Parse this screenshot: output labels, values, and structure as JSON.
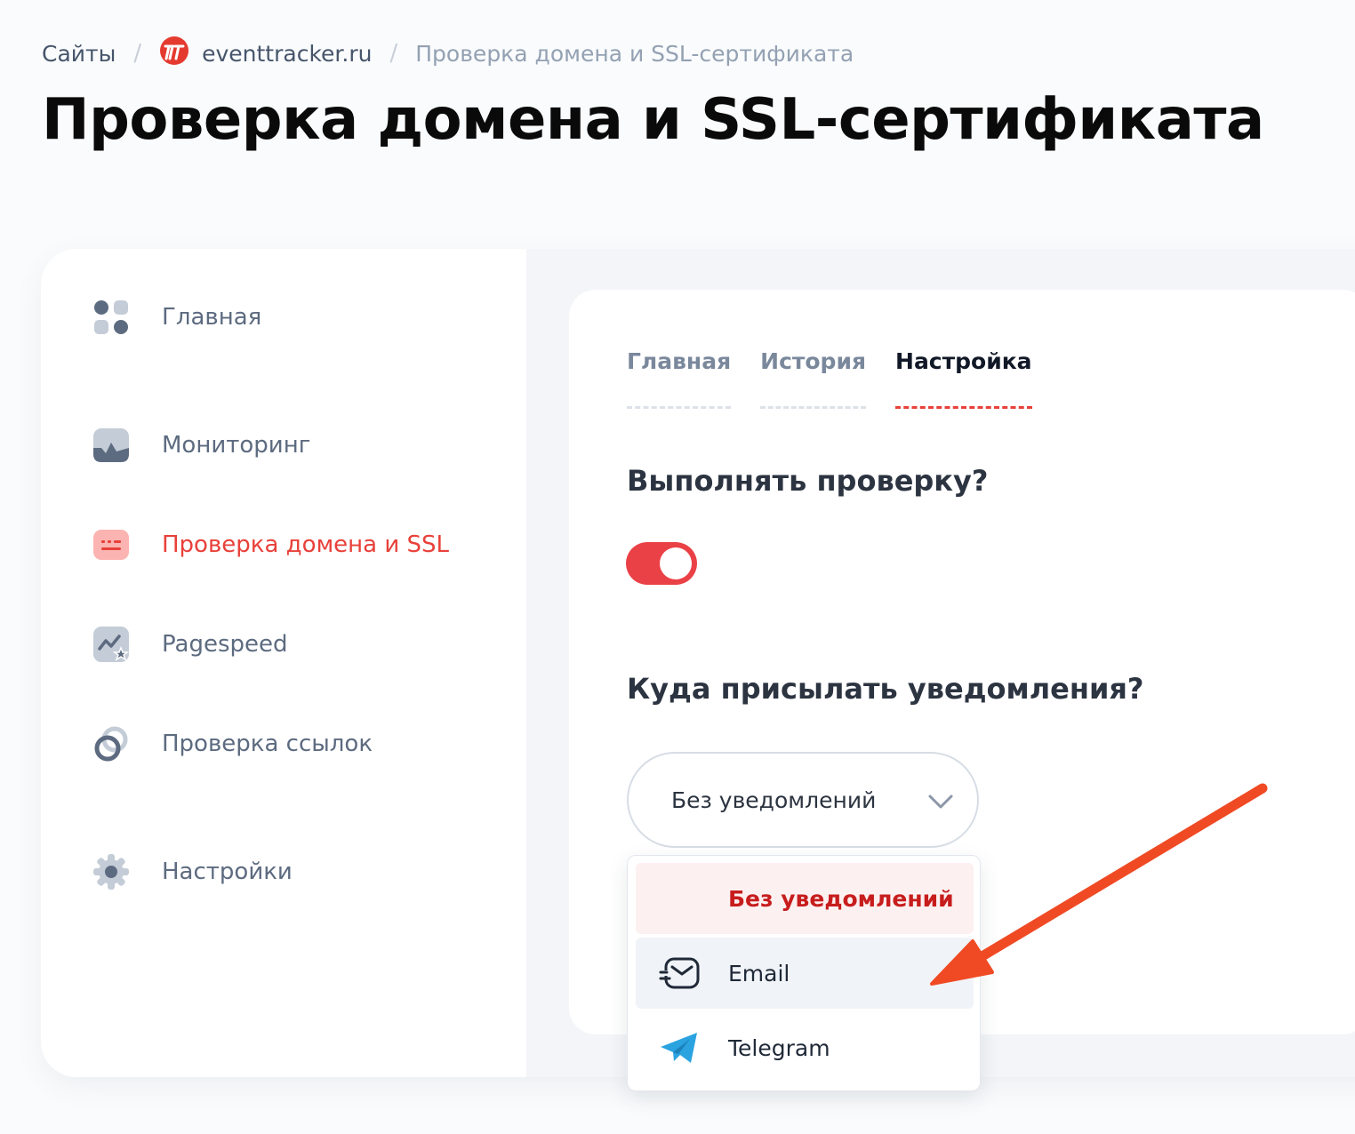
{
  "breadcrumb": {
    "root": "Сайты",
    "site": "eventtracker.ru",
    "current": "Проверка домена и SSL-сертификата"
  },
  "page": {
    "title": "Проверка домена и SSL-сертификата"
  },
  "sidebar": {
    "items": [
      {
        "label": "Главная",
        "icon": "dashboard-icon"
      },
      {
        "label": "Мониторинг",
        "icon": "monitoring-icon"
      },
      {
        "label": "Проверка домена и SSL",
        "icon": "ssl-icon",
        "active": true
      },
      {
        "label": "Pagespeed",
        "icon": "pagespeed-icon"
      },
      {
        "label": "Проверка ссылок",
        "icon": "link-icon"
      },
      {
        "label": "Настройки",
        "icon": "gear-icon"
      }
    ]
  },
  "tabs": [
    {
      "label": "Главная"
    },
    {
      "label": "История"
    },
    {
      "label": "Настройка",
      "active": true
    }
  ],
  "settings": {
    "check_question": "Выполнять проверку?",
    "check_enabled": true,
    "notify_question": "Куда присылать уведомления?",
    "notify_selected": "Без уведомлений",
    "options": [
      {
        "label": "Без уведомлений",
        "icon": ""
      },
      {
        "label": "Email",
        "icon": "mail-icon"
      },
      {
        "label": "Telegram",
        "icon": "telegram-icon"
      }
    ]
  },
  "colors": {
    "accent": "#e8413a",
    "toggle_on": "#ea4147",
    "telegram": "#2aa3e0",
    "annotation_arrow": "#f04a24"
  }
}
